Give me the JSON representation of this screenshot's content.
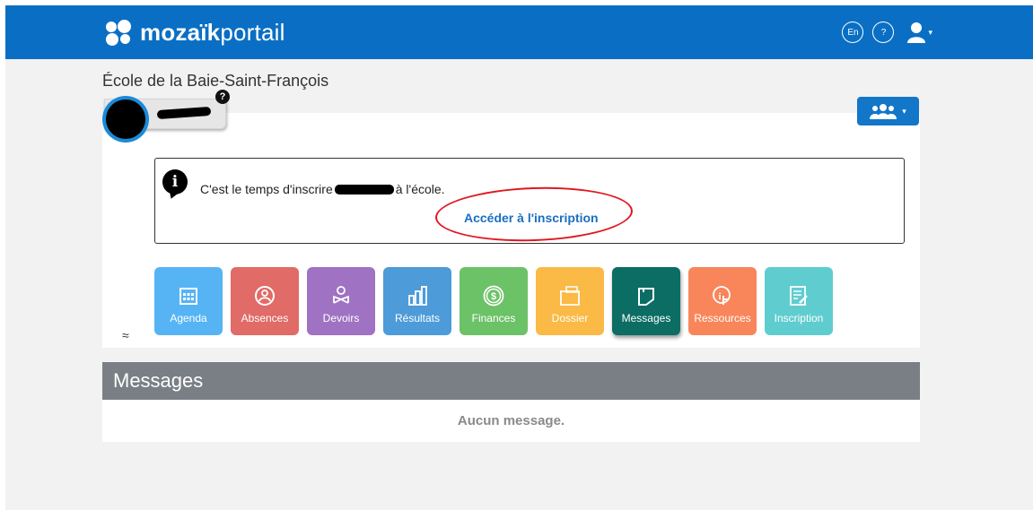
{
  "header": {
    "logo_bold": "mozaïk",
    "logo_light": "portail",
    "lang_button": "En",
    "help_button": "?",
    "user_caret": "▾",
    "brand_color": "#0a6fc4"
  },
  "school": {
    "name": "École de la Baie-Saint-François"
  },
  "child": {
    "help_badge": "?"
  },
  "group_button": {
    "icon": "group-icon",
    "caret": "▾"
  },
  "alert": {
    "icon": "info-icon",
    "text_before": "C'est le temps d'inscrire",
    "text_after": "à l'école.",
    "link": "Accéder à l'inscription"
  },
  "tiles": [
    {
      "label": "Agenda",
      "icon": "calendar-icon"
    },
    {
      "label": "Absences",
      "icon": "absences-icon"
    },
    {
      "label": "Devoirs",
      "icon": "homework-icon"
    },
    {
      "label": "Résultats",
      "icon": "bar-chart-icon"
    },
    {
      "label": "Finances",
      "icon": "dollar-icon"
    },
    {
      "label": "Dossier",
      "icon": "folder-icon"
    },
    {
      "label": "Messages",
      "icon": "message-icon"
    },
    {
      "label": "Ressources",
      "icon": "resources-icon"
    },
    {
      "label": "Inscription",
      "icon": "registration-icon"
    }
  ],
  "collapse_icon": "≈",
  "messages": {
    "title": "Messages",
    "empty": "Aucun message."
  }
}
